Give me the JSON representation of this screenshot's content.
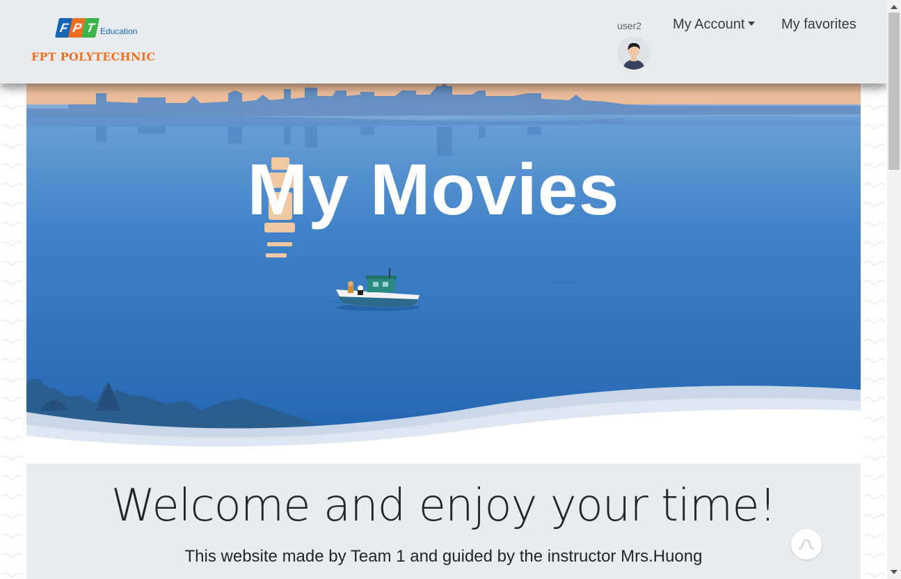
{
  "brand": {
    "logo_letters": [
      "F",
      "P",
      "T"
    ],
    "logo_sub": "Education",
    "logo_name": "FPT POLYTECHNIC",
    "colors": {
      "blue": "#1466b5",
      "orange": "#f26f21",
      "green": "#3bb54a"
    }
  },
  "nav": {
    "username": "user2",
    "avatar_icon": "user-avatar-icon",
    "account_label": "My Account",
    "favorites_label": "My favorites"
  },
  "hero": {
    "title": "My Movies"
  },
  "welcome": {
    "title": "Welcome and enjoy your time!",
    "subtitle": "This website made by Team 1 and guided by the instructor Mrs.Huong"
  },
  "floating_button": {
    "icon": "wave-icon"
  }
}
